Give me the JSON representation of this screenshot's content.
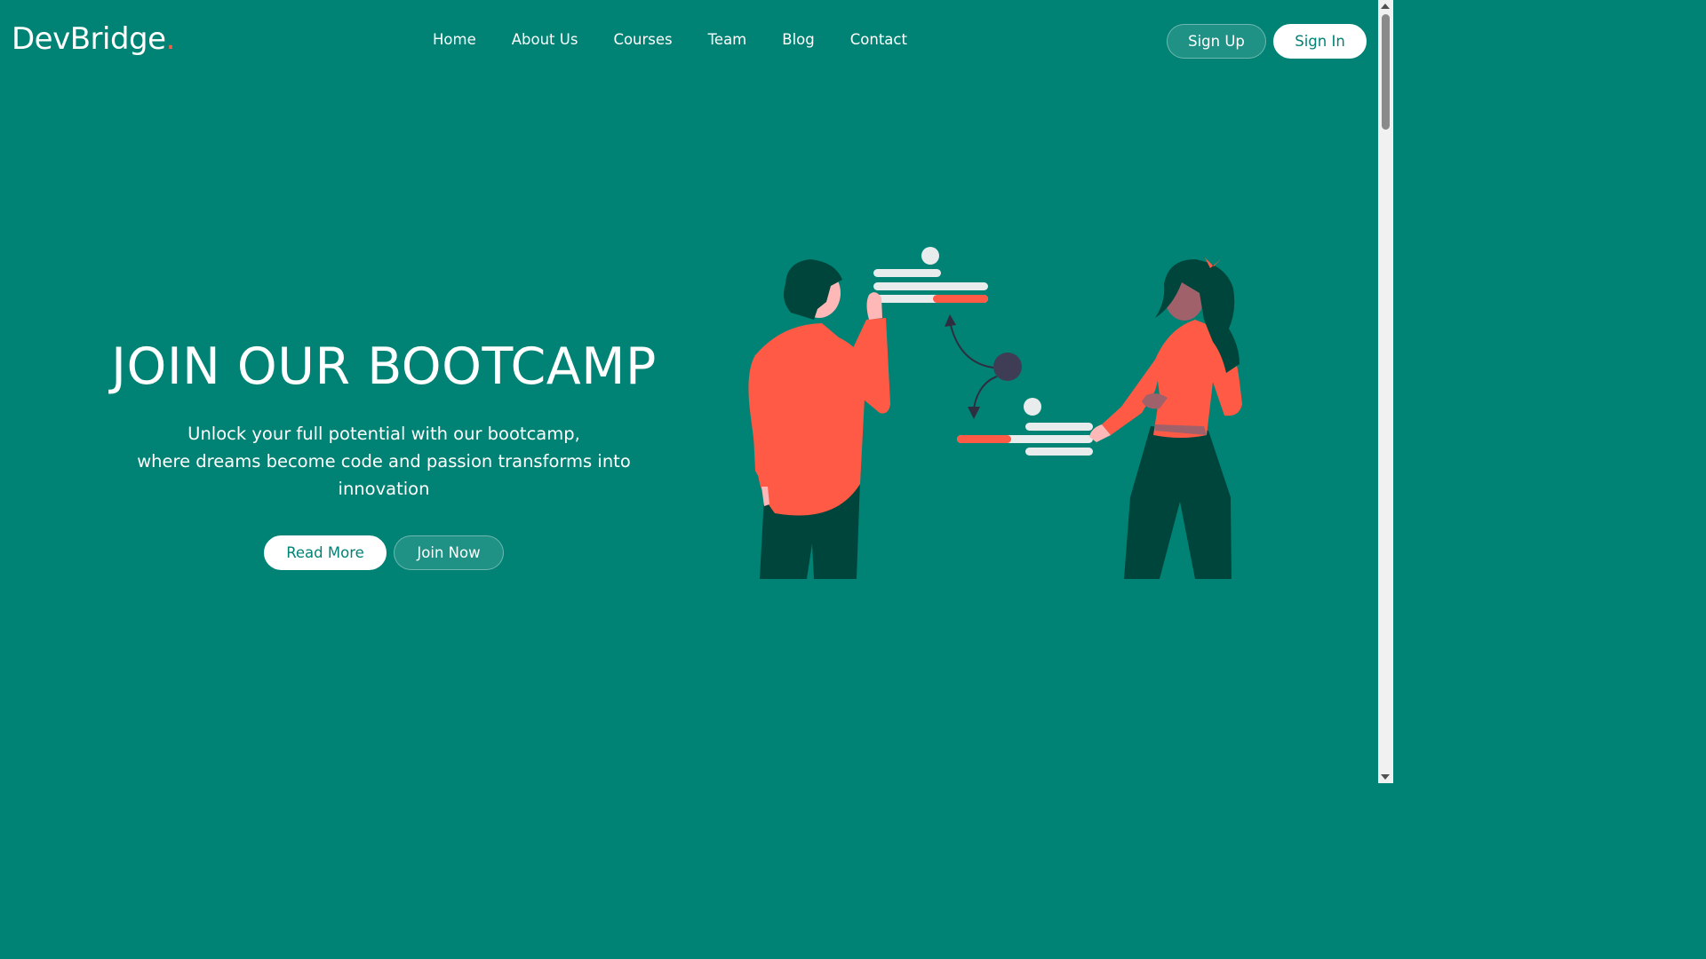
{
  "brand": {
    "name": "DevBridge",
    "dot": "."
  },
  "nav": {
    "links": [
      "Home",
      "About Us",
      "Courses",
      "Team",
      "Blog",
      "Contact"
    ]
  },
  "auth": {
    "signup_label": "Sign Up",
    "signin_label": "Sign In"
  },
  "hero": {
    "title": "JOIN OUR BOOTCAMP",
    "subtitle_line1": "Unlock your full potential with our bootcamp,",
    "subtitle_line2": "where dreams become code and passion transforms into innovation",
    "read_more_label": "Read More",
    "join_now_label": "Join Now"
  },
  "colors": {
    "background": "#008375",
    "accent": "#ff5a45",
    "dark_green": "#00453b",
    "white": "#ffffff"
  },
  "illustration": {
    "icon": "people-collaborating-illustration"
  }
}
